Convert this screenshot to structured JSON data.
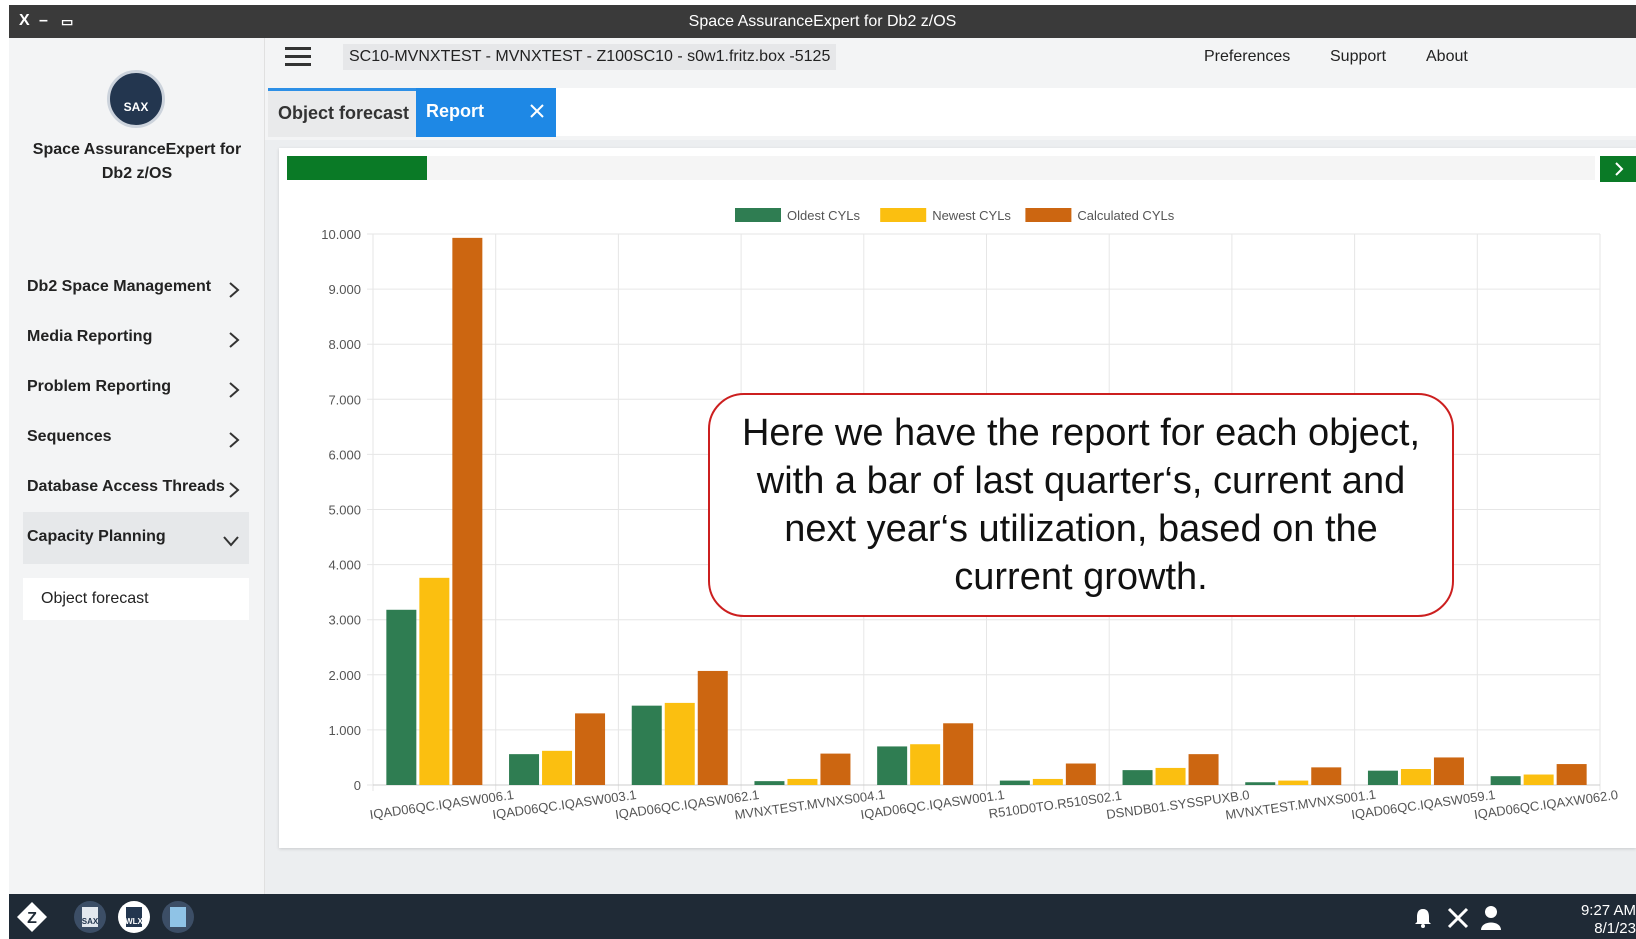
{
  "window": {
    "title": "Space AssuranceExpert for Db2 z/OS",
    "controls": [
      "X",
      "–",
      "▭"
    ]
  },
  "sidebar": {
    "logo_text": "SAX",
    "app_name": "Space AssuranceExpert for Db2 z/OS",
    "items": [
      {
        "label": "Db2 Space Management",
        "expanded": false
      },
      {
        "label": "Media Reporting",
        "expanded": false
      },
      {
        "label": "Problem Reporting",
        "expanded": false
      },
      {
        "label": "Sequences",
        "expanded": false
      },
      {
        "label": "Database Access Threads",
        "expanded": false
      },
      {
        "label": "Capacity Planning",
        "expanded": true
      }
    ],
    "sub_item": "Object forecast"
  },
  "header": {
    "connection": "SC10-MVNXTEST - MVNXTEST - Z100SC10 - s0w1.fritz.box -5125",
    "nav": [
      "Preferences",
      "Support",
      "About"
    ]
  },
  "tabs": [
    {
      "label": "Object forecast",
      "active": false
    },
    {
      "label": "Report",
      "active": true,
      "closable": true
    }
  ],
  "progress": {
    "fraction": 0.107
  },
  "chart_data": {
    "type": "bar",
    "title": "",
    "xlabel": "",
    "ylabel": "",
    "ylim": [
      0,
      10000
    ],
    "yticks": [
      "0",
      "1.000",
      "2.000",
      "3.000",
      "4.000",
      "5.000",
      "6.000",
      "7.000",
      "8.000",
      "9.000",
      "10.000"
    ],
    "grid": true,
    "legend_position": "top",
    "categories": [
      "IQAD06QC.IQASW006.1",
      "IQAD06QC.IQASW003.1",
      "IQAD06QC.IQASW062.1",
      "MVNXTEST.MVNXS004.1",
      "IQAD06QC.IQASW001.1",
      "R510D0TO.R510S02.1",
      "DSNDB01.SYSSPUXB.0",
      "MVNXTEST.MVNXS001.1",
      "IQAD06QC.IQASW059.1",
      "IQAD06QC.IQAXW062.0"
    ],
    "series": [
      {
        "name": "Oldest CYLs",
        "color": "#2f7d52",
        "values": [
          3180,
          560,
          1440,
          70,
          700,
          80,
          270,
          50,
          260,
          160
        ]
      },
      {
        "name": "Newest CYLs",
        "color": "#fbbf10",
        "values": [
          3760,
          620,
          1490,
          110,
          740,
          110,
          310,
          80,
          290,
          190
        ]
      },
      {
        "name": "Calculated CYLs",
        "color": "#cc6611",
        "values": [
          9930,
          1300,
          2070,
          570,
          1120,
          390,
          560,
          320,
          500,
          380
        ]
      }
    ]
  },
  "callout": {
    "text": "Here we have the report for each object, with a bar of last quarter‘s, current and next year‘s utilization, based on the current growth."
  },
  "taskbar": {
    "icons": [
      "zowe-icon",
      "sax-app-icon",
      "wlx-app-icon",
      "third-app-icon"
    ],
    "time": "9:27 AM",
    "date": "8/1/23"
  }
}
